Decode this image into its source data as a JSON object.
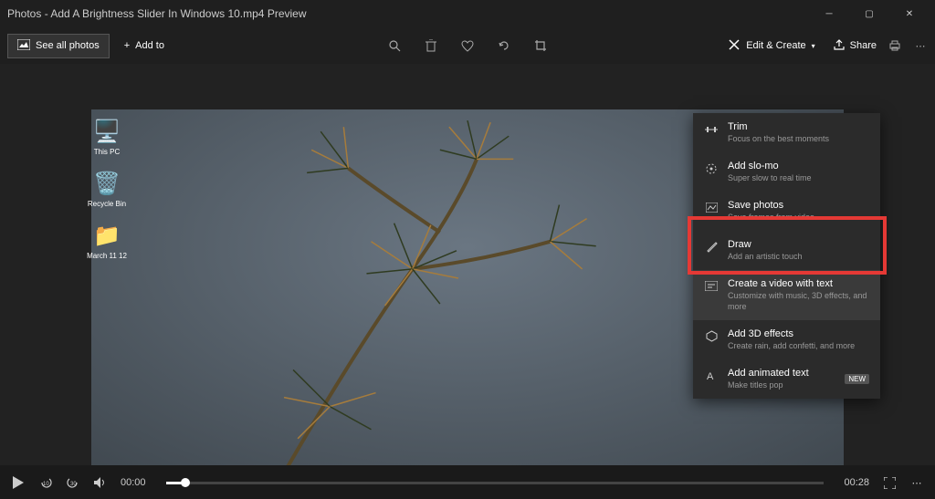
{
  "titlebar": {
    "title": "Photos - Add A Brightness Slider In Windows 10.mp4 Preview"
  },
  "toolbar": {
    "see_all": "See all photos",
    "add_to": "Add to",
    "edit_create": "Edit & Create",
    "share": "Share"
  },
  "desktop": {
    "items": [
      {
        "label": "This PC",
        "glyph": "🖥️"
      },
      {
        "label": "Recycle Bin",
        "glyph": "🗑️"
      },
      {
        "label": "March 11 12",
        "glyph": "📁"
      }
    ]
  },
  "dropdown": {
    "items": [
      {
        "title": "Trim",
        "sub": "Focus on the best moments"
      },
      {
        "title": "Add slo-mo",
        "sub": "Super slow to real time"
      },
      {
        "title": "Save photos",
        "sub": "Save frames from video"
      },
      {
        "title": "Draw",
        "sub": "Add an artistic touch"
      },
      {
        "title": "Create a video with text",
        "sub": "Customize with music, 3D effects, and more"
      },
      {
        "title": "Add 3D effects",
        "sub": "Create rain, add confetti, and more"
      },
      {
        "title": "Add animated text",
        "sub": "Make titles pop",
        "badge": "NEW"
      }
    ]
  },
  "playbar": {
    "current_time": "00:00",
    "total_time": "00:28"
  },
  "annotation": {
    "highlighted_item_index": 4
  }
}
